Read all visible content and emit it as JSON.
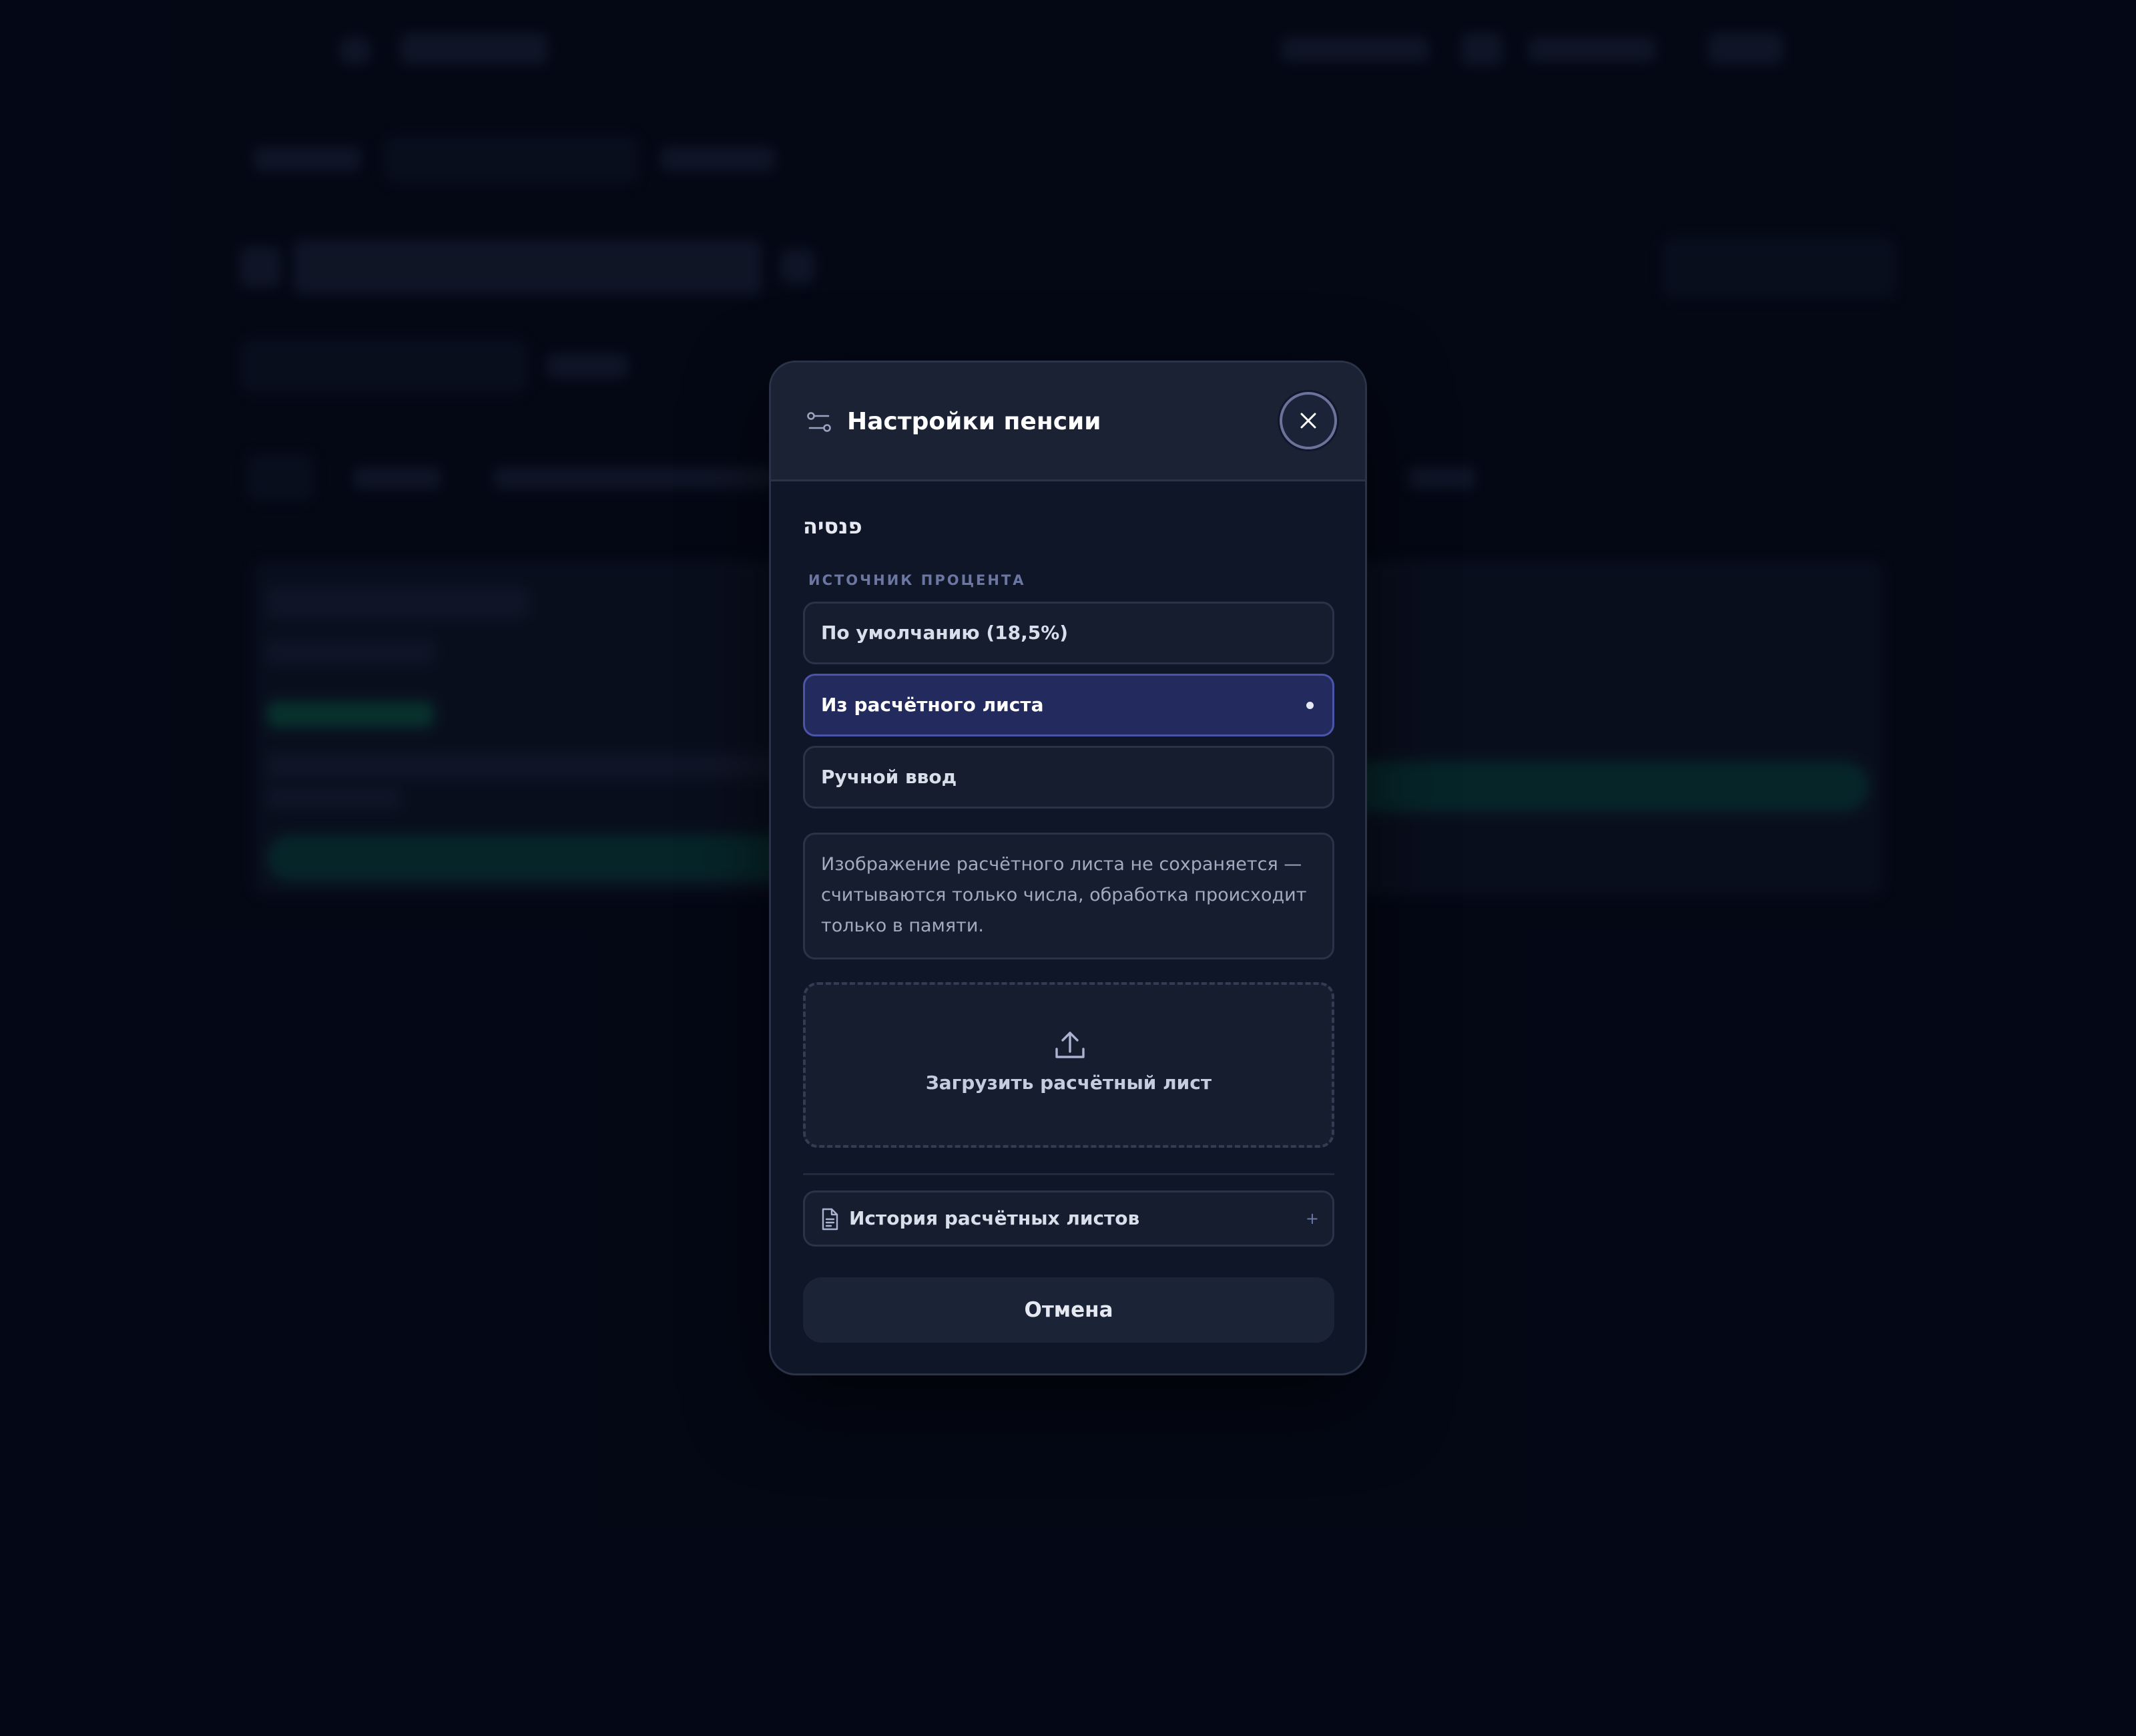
{
  "modal": {
    "title": "Настройки пенсии",
    "hebrew_title": "פנסיה",
    "section_label": "ИСТОЧНИК ПРОЦЕНТА",
    "options": [
      {
        "label": "По умолчанию (18,5%)",
        "selected": false
      },
      {
        "label": "Из расчётного листа",
        "selected": true
      },
      {
        "label": "Ручной ввод",
        "selected": false
      }
    ],
    "info_text": "Изображение расчётного листа не сохраняется — считываются только числа, обработка происходит только в памяти.",
    "upload_label": "Загрузить расчётный лист",
    "history_label": "История расчётных листов",
    "cancel_label": "Отмена"
  },
  "colors": {
    "background": "#050a1a",
    "modal": "#0f1627",
    "selected_option": "#222a5e",
    "accent_muted": "#6b76a3"
  }
}
